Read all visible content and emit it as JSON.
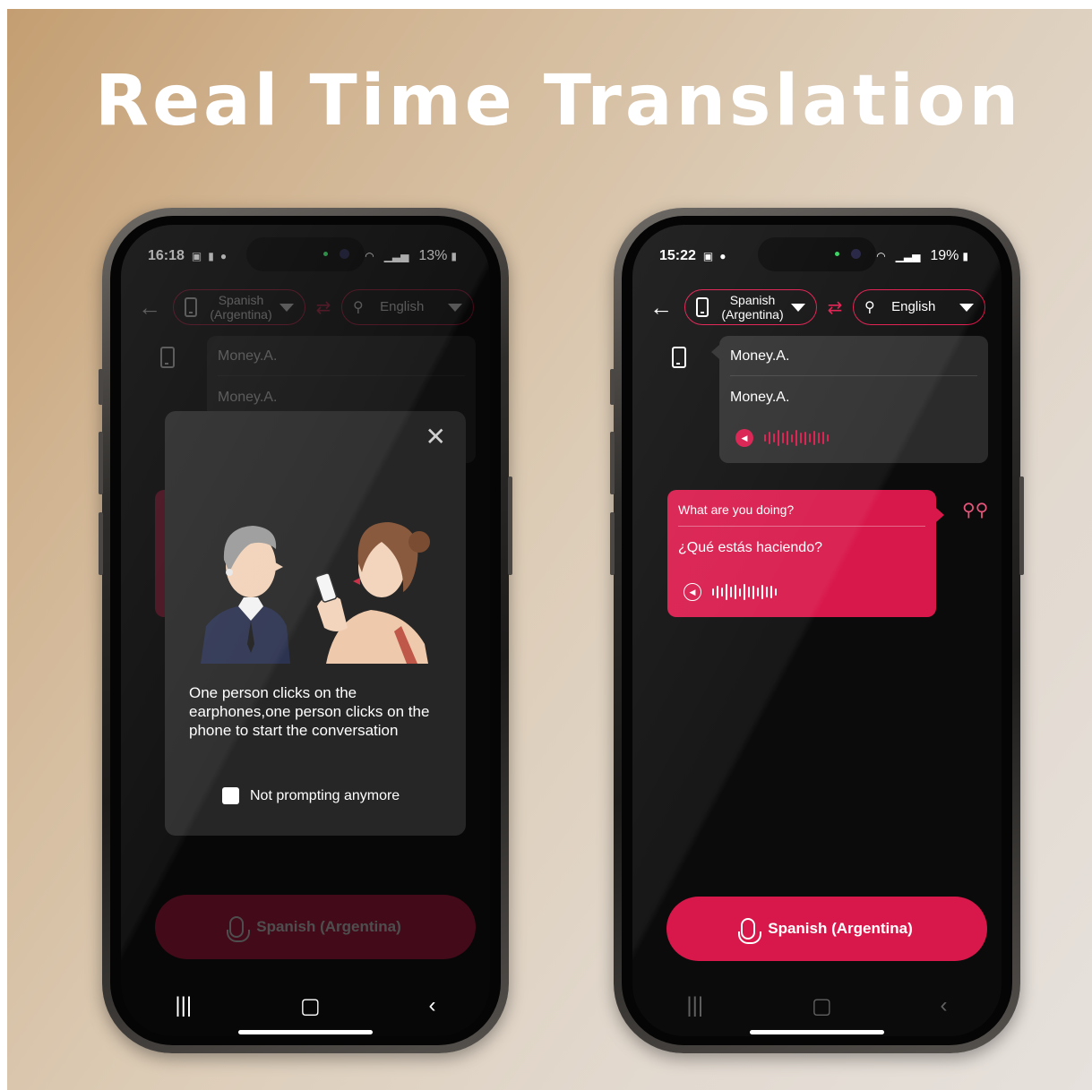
{
  "headline": "Real Time Translation",
  "colors": {
    "accent": "#d8184a",
    "screen_bg": "#0b0b0b",
    "bubble_gray": "#2b2b2b"
  },
  "left_phone": {
    "status": {
      "time": "16:18",
      "battery": "13%"
    },
    "topbar": {
      "source_language": "Spanish\n(Argentina)",
      "target_language": "English"
    },
    "bubble": {
      "line1": "Money.A.",
      "line2": "Money.A."
    },
    "modal": {
      "message": "One person clicks on the earphones,one person clicks on the phone to start the conversation",
      "checkbox_label": "Not prompting anymore"
    },
    "mic_button": "Spanish (Argentina)"
  },
  "right_phone": {
    "status": {
      "time": "15:22",
      "battery": "19%"
    },
    "topbar": {
      "source_language": "Spanish\n(Argentina)",
      "target_language": "English"
    },
    "bubble_gray": {
      "line1": "Money.A.",
      "line2": "Money.A."
    },
    "bubble_red": {
      "line1": "What are you doing?",
      "line2": "¿Qué estás haciendo?"
    },
    "mic_button": "Spanish (Argentina)"
  },
  "icons": [
    "back-arrow-icon",
    "phone-icon",
    "swap-icon",
    "earbuds-icon",
    "speaker-icon",
    "mic-icon",
    "close-icon",
    "recent-apps-icon",
    "home-icon",
    "nav-back-icon"
  ]
}
